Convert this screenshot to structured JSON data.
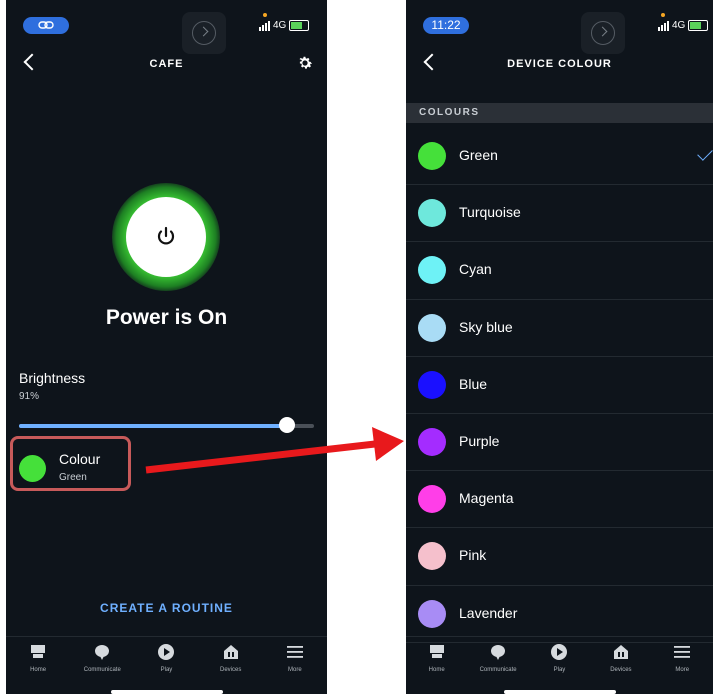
{
  "left": {
    "status": {
      "pill_text": "",
      "network": "4G"
    },
    "header": {
      "title": "CAFE"
    },
    "power": {
      "label": "Power is On"
    },
    "brightness": {
      "label": "Brightness",
      "value_text": "91%",
      "level": 0.91
    },
    "colour": {
      "title": "Colour",
      "value": "Green",
      "swatch_color": "#45e03a"
    },
    "routine_link": "CREATE A ROUTINE",
    "nav": [
      {
        "label": "Home",
        "icon": "home-icon"
      },
      {
        "label": "Communicate",
        "icon": "chat-bubble-icon"
      },
      {
        "label": "Play",
        "icon": "play-icon"
      },
      {
        "label": "Devices",
        "icon": "devices-icon"
      },
      {
        "label": "More",
        "icon": "menu-icon"
      }
    ]
  },
  "right": {
    "status": {
      "time": "11:22",
      "network": "4G"
    },
    "header": {
      "title": "DEVICE COLOUR"
    },
    "section": "COLOURS",
    "colours": [
      {
        "label": "Green",
        "color": "#45e03a",
        "selected": true
      },
      {
        "label": "Turquoise",
        "color": "#6ee8dc",
        "selected": false
      },
      {
        "label": "Cyan",
        "color": "#6ef2f6",
        "selected": false
      },
      {
        "label": "Sky blue",
        "color": "#a9dcf5",
        "selected": false
      },
      {
        "label": "Blue",
        "color": "#1a10ff",
        "selected": false
      },
      {
        "label": "Purple",
        "color": "#a42cff",
        "selected": false
      },
      {
        "label": "Magenta",
        "color": "#ff3ee8",
        "selected": false
      },
      {
        "label": "Pink",
        "color": "#f5c0cc",
        "selected": false
      },
      {
        "label": "Lavender",
        "color": "#a88cf5",
        "selected": false
      }
    ],
    "nav": [
      {
        "label": "Home",
        "icon": "home-icon"
      },
      {
        "label": "Communicate",
        "icon": "chat-bubble-icon"
      },
      {
        "label": "Play",
        "icon": "play-icon"
      },
      {
        "label": "Devices",
        "icon": "devices-icon"
      },
      {
        "label": "More",
        "icon": "menu-icon"
      }
    ]
  },
  "annotation": {
    "highlight_color": "#c75a5a",
    "arrow_color": "#e8191c"
  }
}
